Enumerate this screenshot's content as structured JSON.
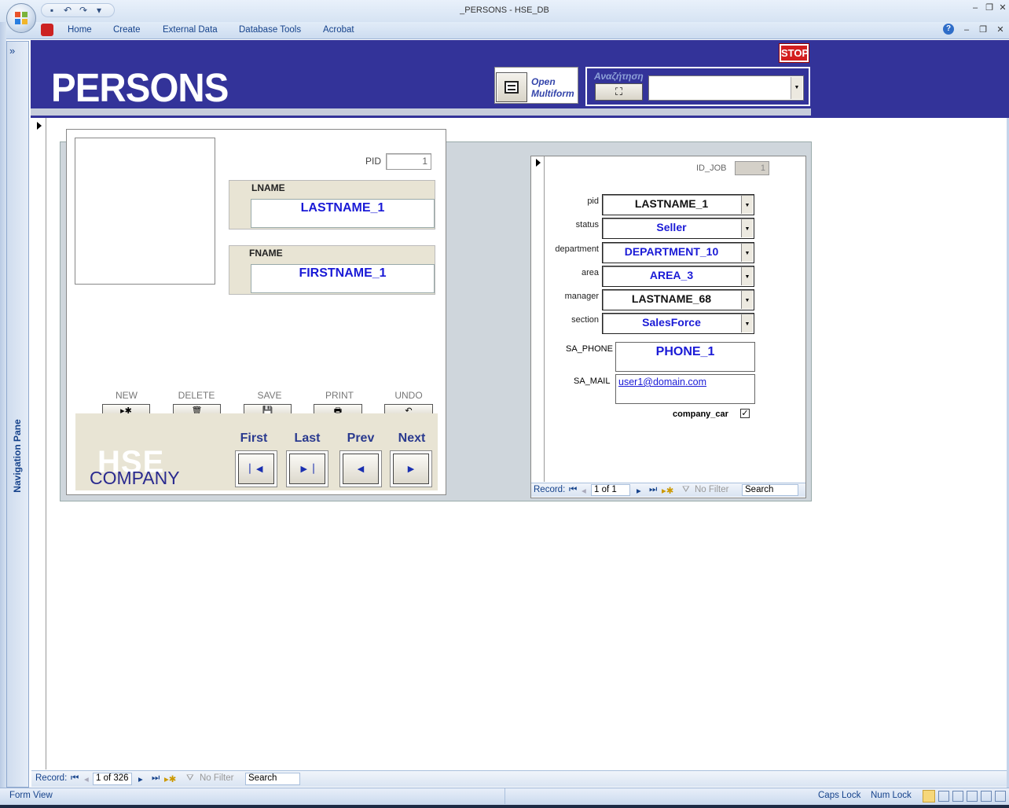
{
  "window": {
    "title": "_PERSONS - HSE_DB"
  },
  "ribbon": {
    "tabs": [
      "Home",
      "Create",
      "External Data",
      "Database Tools",
      "Acrobat"
    ]
  },
  "nav_pane": {
    "label": "Navigation Pane",
    "expand_glyph": "»"
  },
  "header": {
    "title": "PERSONS",
    "stop_label": "STOP",
    "open_multiform_line1": "Open",
    "open_multiform_line2": "Multiform",
    "search_label": "Αναζήτηση",
    "search_value": ""
  },
  "person": {
    "pid_label": "PID",
    "pid_value": "1",
    "lname_label": "LNAME",
    "lname_value": "LASTNAME_1",
    "fname_label": "FNAME",
    "fname_value": "FIRSTNAME_1"
  },
  "commands": [
    {
      "label": "NEW",
      "glyph": "▸✱"
    },
    {
      "label": "DELETE",
      "glyph": "🗑"
    },
    {
      "label": "SAVE",
      "glyph": "💾"
    },
    {
      "label": "PRINT",
      "glyph": "🖶"
    },
    {
      "label": "UNDO",
      "glyph": "↶"
    }
  ],
  "navigation": {
    "first": "First",
    "last": "Last",
    "prev": "Prev",
    "next": "Next",
    "logo_text": "HSE",
    "company": "COMPANY"
  },
  "job": {
    "id_job_label": "ID_JOB",
    "id_job_value": "1",
    "pid_label": "pid",
    "pid_value": "LASTNAME_1",
    "status_label": "status",
    "status_value": "Seller",
    "department_label": "department",
    "department_value": "DEPARTMENT_10",
    "area_label": "area",
    "area_value": "AREA_3",
    "manager_label": "manager",
    "manager_value": "LASTNAME_68",
    "section_label": "section",
    "section_value": "SalesForce",
    "phone_label": "SA_PHONE",
    "phone_value": "PHONE_1",
    "mail_label": "SA_MAIL",
    "mail_value": "user1@domain.com",
    "company_car_label": "company_car",
    "company_car_checked": true
  },
  "subform_recbar": {
    "record_label": "Record:",
    "position": "1 of 1",
    "filter": "No Filter",
    "search": "Search"
  },
  "main_recbar": {
    "record_label": "Record:",
    "position": "1 of 326",
    "filter": "No Filter",
    "search": "Search"
  },
  "status_bar": {
    "view": "Form View",
    "caps": "Caps Lock",
    "num": "Num Lock"
  },
  "colors": {
    "header_bg": "#333399",
    "field_text": "#1a1ad6",
    "panel_beige": "#e8e4d4"
  }
}
